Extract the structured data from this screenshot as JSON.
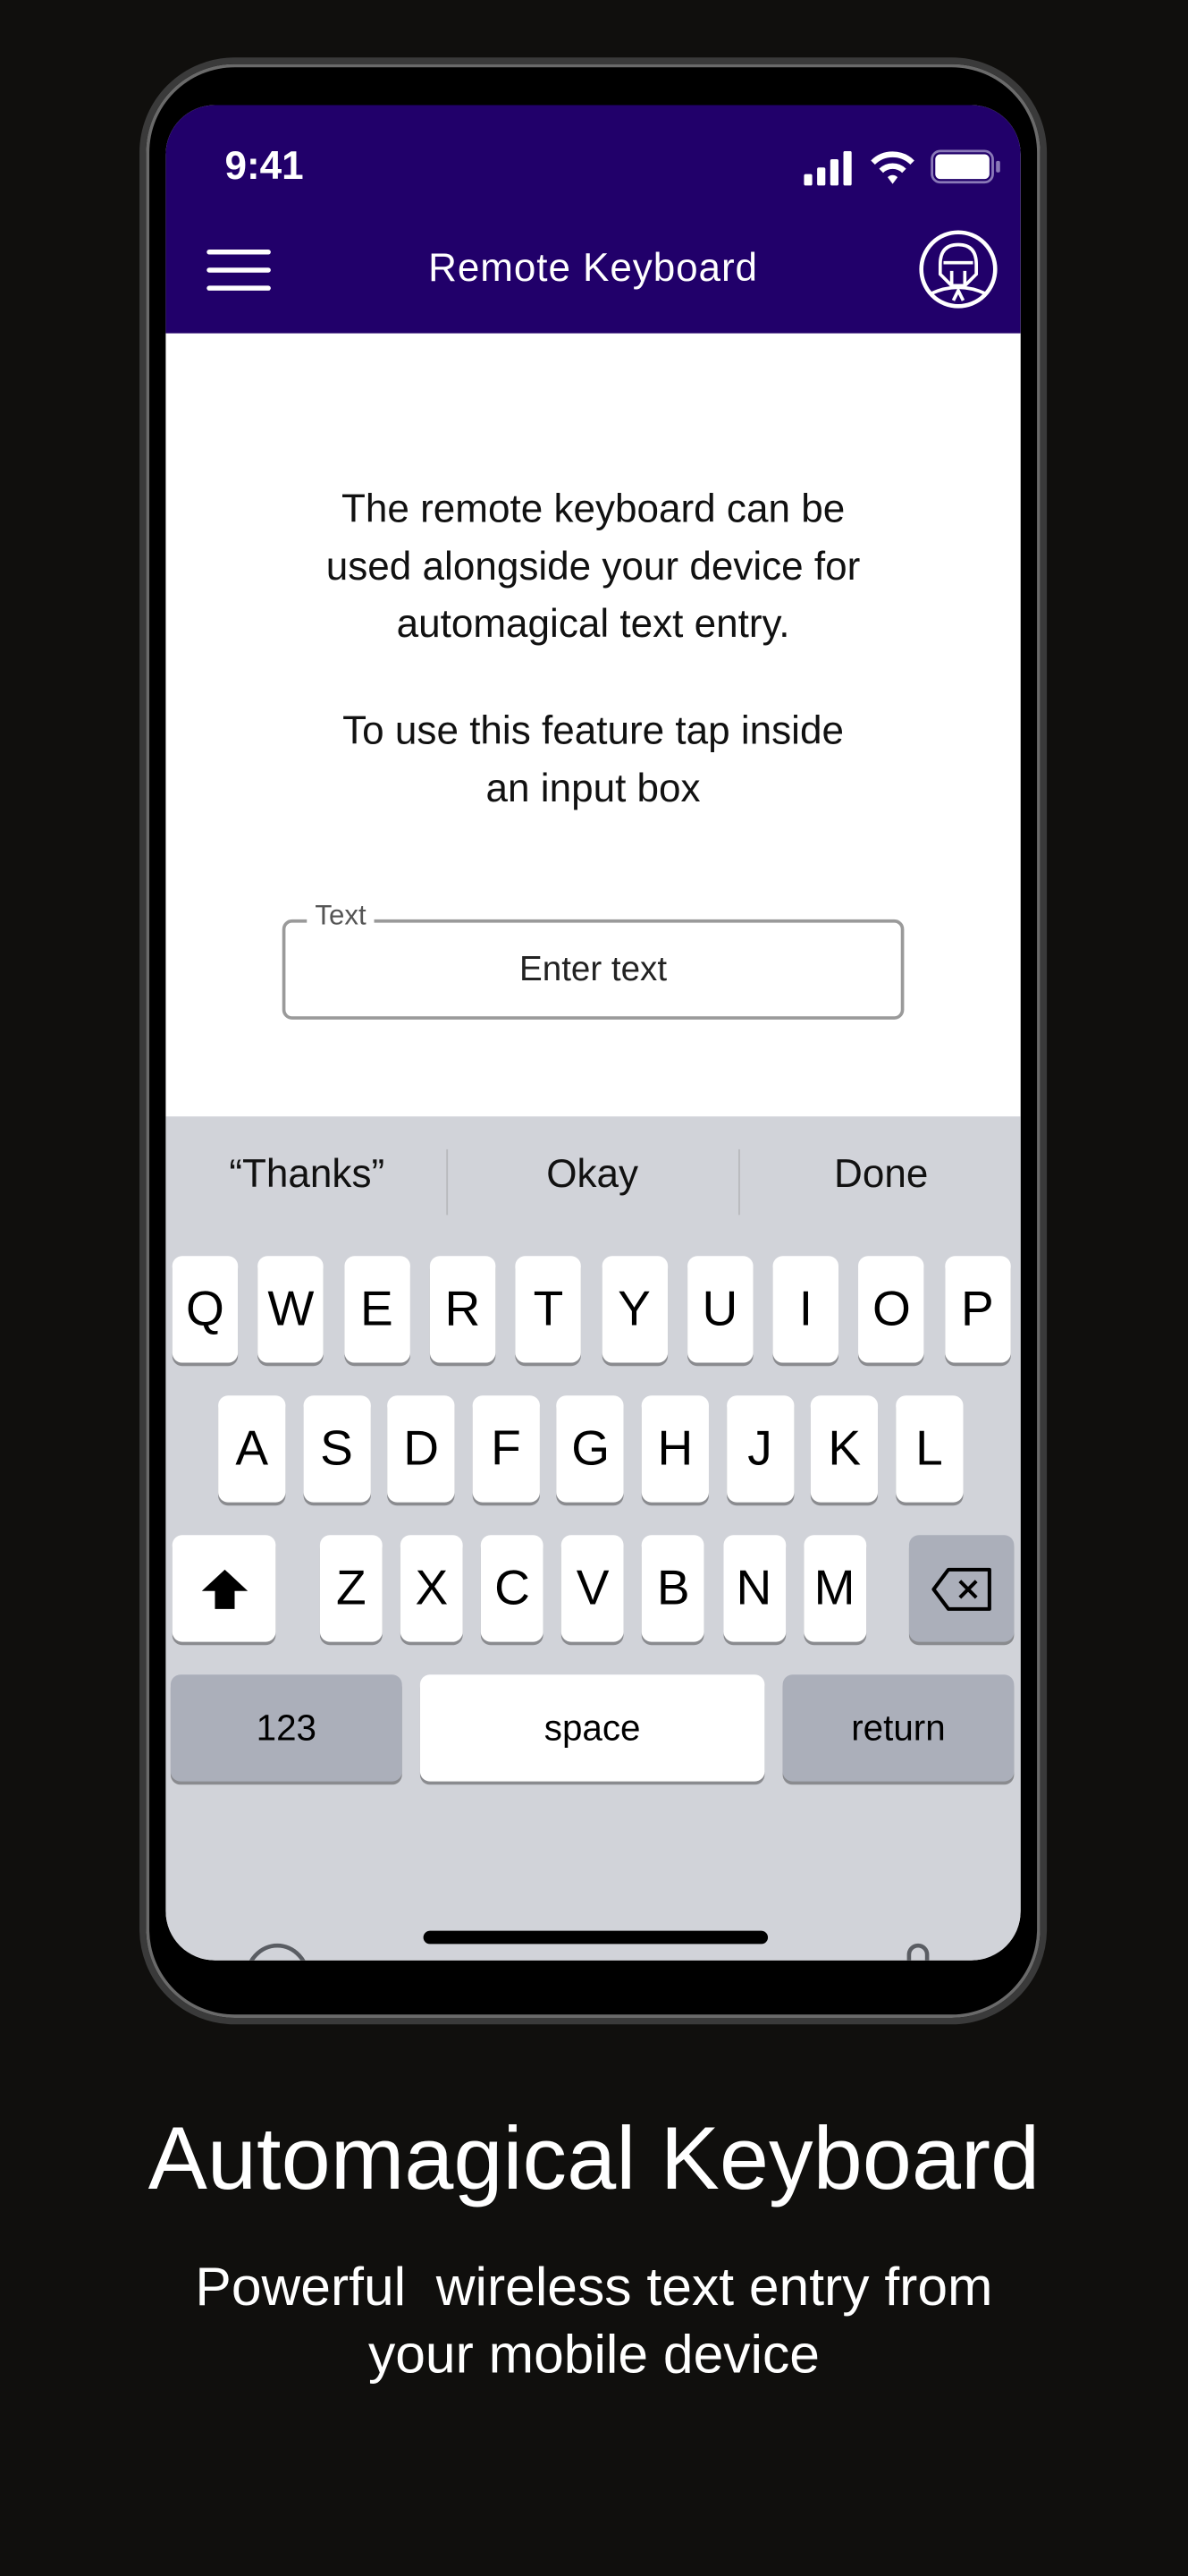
{
  "status_bar": {
    "time": "9:41",
    "icons": [
      "signal-icon",
      "wifi-icon",
      "battery-icon"
    ]
  },
  "header": {
    "title": "Remote Keyboard",
    "menu_icon": "hamburger-menu-icon",
    "logo_icon": "helmet-logo-icon",
    "color": "#21006a"
  },
  "content": {
    "intro_lines": [
      "The remote keyboard can be",
      "used alongside your device for",
      "automagical text entry."
    ],
    "instruction_lines": [
      "To use this feature tap inside",
      "an input box"
    ],
    "input": {
      "label": "Text",
      "placeholder": "Enter text",
      "value": ""
    }
  },
  "keyboard": {
    "suggestions": [
      "“Thanks”",
      "Okay",
      "Done"
    ],
    "rows": [
      [
        "Q",
        "W",
        "E",
        "R",
        "T",
        "Y",
        "U",
        "I",
        "O",
        "P"
      ],
      [
        "A",
        "S",
        "D",
        "F",
        "G",
        "H",
        "J",
        "K",
        "L"
      ],
      [
        "Z",
        "X",
        "C",
        "V",
        "B",
        "N",
        "M"
      ]
    ],
    "numbers_label": "123",
    "space_label": "space",
    "return_label": "return",
    "icons": {
      "shift": "shift-icon",
      "delete": "delete-icon",
      "emoji": "emoji-icon",
      "mic": "microphone-icon"
    }
  },
  "promo": {
    "headline": "Automagical Keyboard",
    "subtitle_lines": [
      "Powerful  wireless text entry from",
      "your mobile device"
    ]
  }
}
